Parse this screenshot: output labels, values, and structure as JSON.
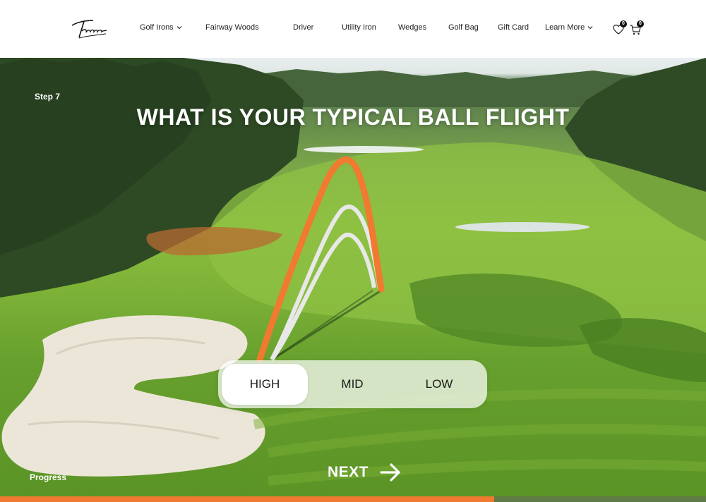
{
  "brand": {
    "logo_text": "Takomo"
  },
  "nav": {
    "items": [
      {
        "label": "Golf Irons",
        "dropdown": true
      },
      {
        "label": "Fairway Woods",
        "dropdown": false
      },
      {
        "label": "Driver",
        "dropdown": false
      },
      {
        "label": "Utility Iron",
        "dropdown": false
      },
      {
        "label": "Wedges",
        "dropdown": false
      },
      {
        "label": "Golf Bag",
        "dropdown": false
      },
      {
        "label": "Gift Card",
        "dropdown": false
      },
      {
        "label": "Learn More",
        "dropdown": true
      }
    ],
    "wishlist": {
      "icon": "heart-icon",
      "count": "0"
    },
    "cart": {
      "icon": "cart-icon",
      "count": "0"
    }
  },
  "quiz": {
    "step_label": "Step 7",
    "question": "WHAT IS YOUR TYPICAL BALL FLIGHT",
    "options": [
      {
        "label": "HIGH",
        "selected": true
      },
      {
        "label": "MID",
        "selected": false
      },
      {
        "label": "LOW",
        "selected": false
      }
    ],
    "next_label": "NEXT",
    "progress_label": "Progress",
    "progress_fraction": 0.7
  },
  "colors": {
    "accent": "#f07a30",
    "selected_trajectory": "#f07a30",
    "unselected_trajectory": "#e8e8e8"
  }
}
